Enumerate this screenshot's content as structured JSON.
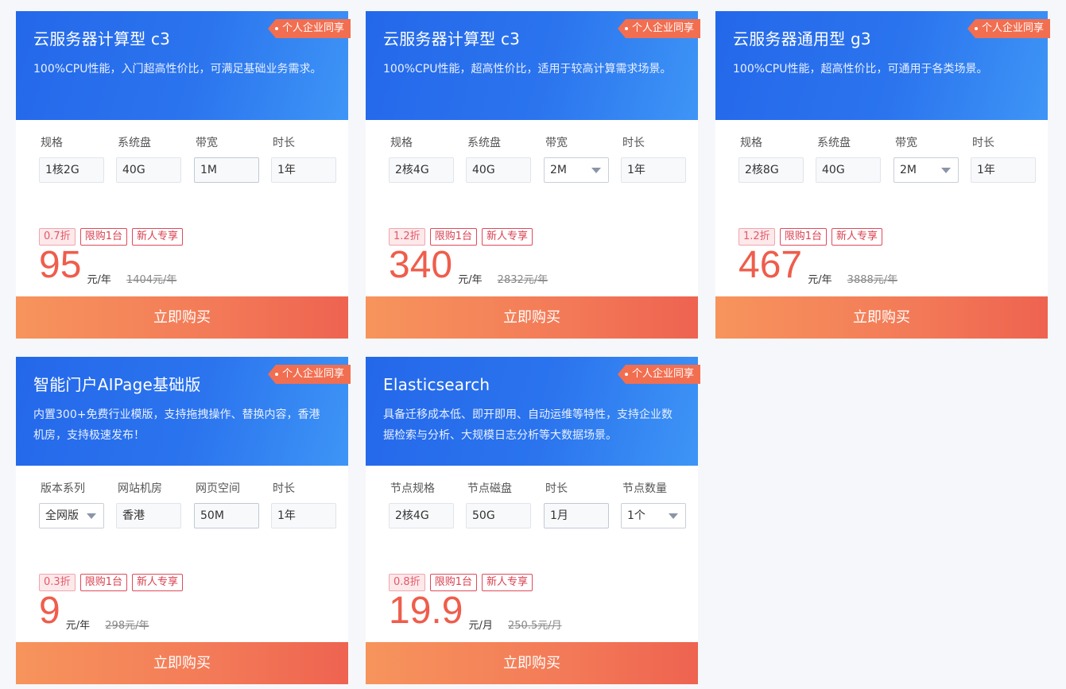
{
  "theme": {
    "head_blue": "#2468ea",
    "accent_red": "#ef5d4c",
    "buy_orange": "#f7945c",
    "tag_orange": "#f26e50"
  },
  "cards": [
    {
      "title": "云服务器计算型 c3",
      "desc": "100%CPU性能，入门超高性价比，可满足基础业务需求。",
      "tag": "个人企业同享",
      "fields": [
        {
          "label": "规格",
          "value": "1核2G",
          "type": "static"
        },
        {
          "label": "系统盘",
          "value": "40G",
          "type": "static"
        },
        {
          "label": "带宽",
          "value": "1M",
          "type": "active"
        },
        {
          "label": "时长",
          "value": "1年",
          "type": "static"
        }
      ],
      "badges": [
        "0.7折",
        "限购1台",
        "新人专享"
      ],
      "price": "95",
      "unit": "元/年",
      "original": "1404元/年",
      "buy": "立即购买"
    },
    {
      "title": "云服务器计算型 c3",
      "desc": "100%CPU性能，超高性价比，适用于较高计算需求场景。",
      "tag": "个人企业同享",
      "fields": [
        {
          "label": "规格",
          "value": "2核4G",
          "type": "static"
        },
        {
          "label": "系统盘",
          "value": "40G",
          "type": "static"
        },
        {
          "label": "带宽",
          "value": "2M",
          "type": "select"
        },
        {
          "label": "时长",
          "value": "1年",
          "type": "static"
        }
      ],
      "badges": [
        "1.2折",
        "限购1台",
        "新人专享"
      ],
      "price": "340",
      "unit": "元/年",
      "original": "2832元/年",
      "buy": "立即购买"
    },
    {
      "title": "云服务器通用型 g3",
      "desc": "100%CPU性能，超高性价比，可通用于各类场景。",
      "tag": "个人企业同享",
      "fields": [
        {
          "label": "规格",
          "value": "2核8G",
          "type": "static"
        },
        {
          "label": "系统盘",
          "value": "40G",
          "type": "static"
        },
        {
          "label": "带宽",
          "value": "2M",
          "type": "select"
        },
        {
          "label": "时长",
          "value": "1年",
          "type": "static"
        }
      ],
      "badges": [
        "1.2折",
        "限购1台",
        "新人专享"
      ],
      "price": "467",
      "unit": "元/年",
      "original": "3888元/年",
      "buy": "立即购买"
    },
    {
      "title": "智能门户AIPage基础版",
      "desc": "内置300+免费行业模版，支持拖拽操作、替换内容，香港机房，支持极速发布！",
      "tag": "个人企业同享",
      "fields": [
        {
          "label": "版本系列",
          "value": "全网版",
          "type": "select"
        },
        {
          "label": "网站机房",
          "value": "香港",
          "type": "static"
        },
        {
          "label": "网页空间",
          "value": "50M",
          "type": "active"
        },
        {
          "label": "时长",
          "value": "1年",
          "type": "static"
        }
      ],
      "badges": [
        "0.3折",
        "限购1台",
        "新人专享"
      ],
      "price": "9",
      "unit": "元/年",
      "original": "298元/年",
      "buy": "立即购买"
    },
    {
      "title": "Elasticsearch",
      "desc": "具备迁移成本低、即开即用、自动运维等特性，支持企业数据检索与分析、大规模日志分析等大数据场景。",
      "tag": "个人企业同享",
      "fields": [
        {
          "label": "节点规格",
          "value": "2核4G",
          "type": "static"
        },
        {
          "label": "节点磁盘",
          "value": "50G",
          "type": "static"
        },
        {
          "label": "时长",
          "value": "1月",
          "type": "active"
        },
        {
          "label": "节点数量",
          "value": "1个",
          "type": "select"
        }
      ],
      "badges": [
        "0.8折",
        "限购1台",
        "新人专享"
      ],
      "price": "19.9",
      "unit": "元/月",
      "original": "250.5元/月",
      "buy": "立即购买"
    }
  ]
}
